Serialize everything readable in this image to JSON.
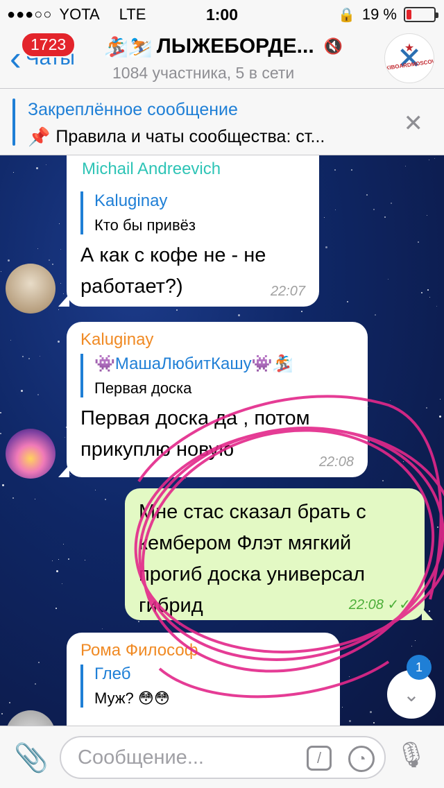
{
  "status": {
    "signal": "●●●○○",
    "carrier": "YOTA",
    "network": "LTE",
    "time": "1:00",
    "battery": "19 %",
    "battery_level": 0.19
  },
  "nav": {
    "back_label": "Чаты",
    "unread_badge": "1723",
    "chat_emoji": "🏂⛷️",
    "chat_title": "ЛЫЖЕБОРДЕ...",
    "chat_subtitle": "1084 участника, 5 в сети",
    "group_logo_text": "SKIBOARDMOSCOW"
  },
  "pinned": {
    "title": "Закреплённое сообщение",
    "pin_emoji": "📌",
    "text": "Правила и чаты сообщества: ст..."
  },
  "messages": [
    {
      "sender": "Michail Andreevich",
      "sender_color": "#2ec4b6",
      "reply_name": "Kaluginay",
      "reply_text": "Кто бы привёз",
      "text": "А как с кофе не - не работает?)",
      "time": "22:07"
    },
    {
      "sender": "Kaluginay",
      "sender_color": "#f08a24",
      "reply_name": "👾МашаЛюбитКашу👾🏂",
      "reply_text": "Первая доска",
      "text": "Первая доска да , потом прикуплю новую",
      "time": "22:08"
    },
    {
      "text": "Мне стас сказал брать с кембером Флэт мягкий прогиб доска универсал гибрид",
      "time": "22:08",
      "status": "✓✓"
    },
    {
      "sender": "Рома Философ",
      "sender_color": "#f08a24",
      "reply_name": "Глеб",
      "reply_text": "Муж? 😳😳"
    }
  ],
  "scroll": {
    "badge": "1",
    "icon": "chevron-down-icon"
  },
  "input": {
    "placeholder": "Сообщение..."
  },
  "colors": {
    "accent": "#1f7fd6",
    "outgoing_bubble": "#e3f9c4",
    "annotation_circle": "#e3288a"
  }
}
